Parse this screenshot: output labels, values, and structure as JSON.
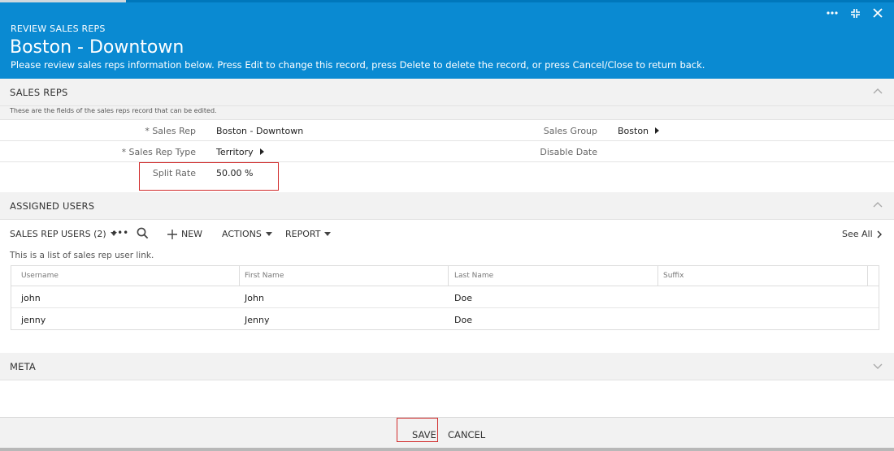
{
  "header": {
    "module": "REVIEW SALES REPS",
    "title": "Boston - Downtown",
    "subtitle": "Please review sales reps information below. Press Edit to change this record, press Delete to delete the record, or press Cancel/Close to return back."
  },
  "sales_reps": {
    "section_label": "SALES REPS",
    "description": "These are the fields of the sales reps record that can be edited.",
    "fields": {
      "sales_rep_label": "* Sales Rep",
      "sales_rep_value": "Boston - Downtown",
      "sales_group_label": "Sales Group",
      "sales_group_value": "Boston",
      "sales_rep_type_label": "* Sales Rep Type",
      "sales_rep_type_value": "Territory",
      "disable_date_label": "Disable Date",
      "split_rate_label": "Split Rate",
      "split_rate_value": "50.00 %"
    }
  },
  "assigned_users": {
    "section_label": "ASSIGNED USERS",
    "toolbar": {
      "list_title": "SALES REP USERS (2)",
      "more": "•••",
      "new_label": "NEW",
      "actions_label": "ACTIONS",
      "report_label": "REPORT",
      "see_all": "See All"
    },
    "description": "This is a list of sales rep user link.",
    "columns": [
      "Username",
      "First Name",
      "Last Name",
      "Suffix"
    ],
    "rows": [
      {
        "username": "john",
        "first_name": "John",
        "last_name": "Doe",
        "suffix": ""
      },
      {
        "username": "jenny",
        "first_name": "Jenny",
        "last_name": "Doe",
        "suffix": ""
      }
    ]
  },
  "meta": {
    "section_label": "META"
  },
  "footer": {
    "save_label": "SAVE",
    "cancel_label": "CANCEL"
  },
  "colors": {
    "header_bg": "#0a8ad2",
    "highlight": "#d12b2b",
    "section_bg": "#f2f2f2"
  },
  "icons": [
    "more-icon",
    "minimize-icon",
    "close-icon",
    "chevron-up-icon",
    "chevron-down-icon",
    "caret-right-icon",
    "search-icon",
    "plus-icon",
    "caret-down-icon",
    "chevron-right-icon"
  ]
}
